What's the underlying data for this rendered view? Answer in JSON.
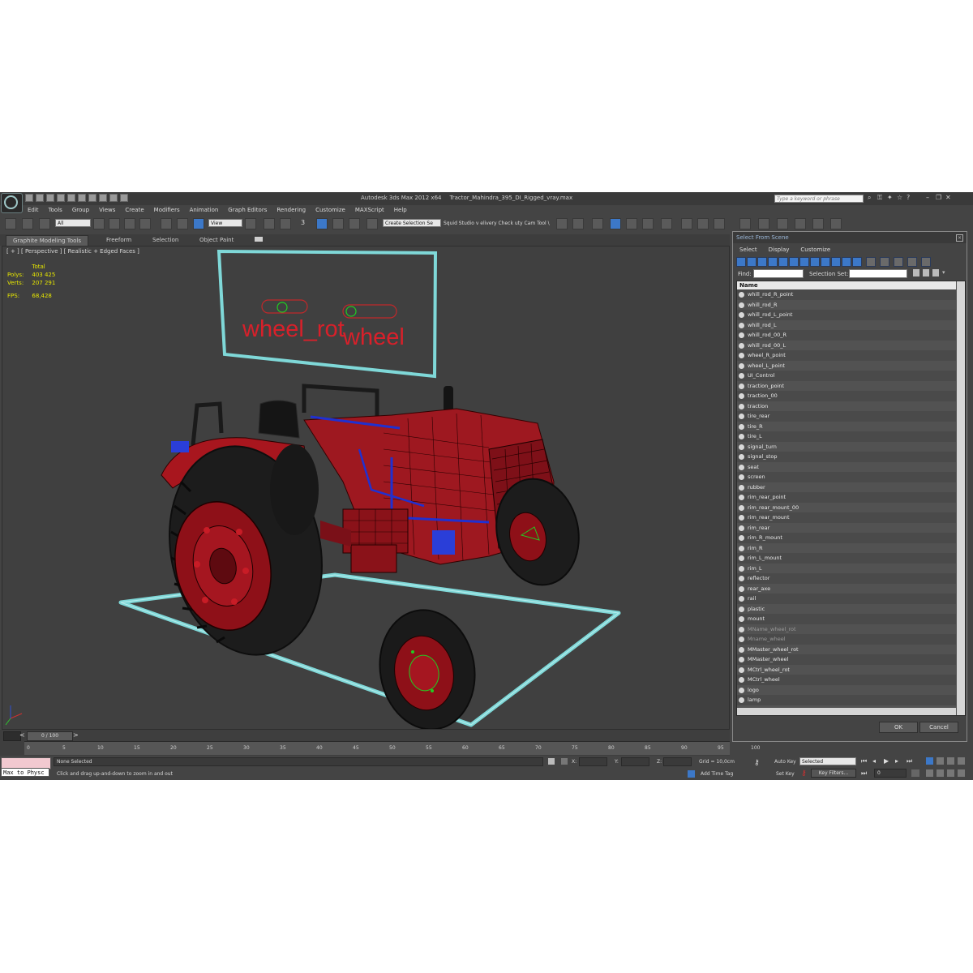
{
  "window": {
    "app_name": "Autodesk 3ds Max  2012 x64",
    "file_name": "Tractor_Mahindra_395_DI_Rigged_vray.max",
    "search_placeholder": "Type a keyword or phrase"
  },
  "menu": [
    "Edit",
    "Tools",
    "Group",
    "Views",
    "Create",
    "Modifiers",
    "Animation",
    "Graph Editors",
    "Rendering",
    "Customize",
    "MAXScript",
    "Help"
  ],
  "toolbar": {
    "filter_select": "All",
    "ref_coord_select": "View",
    "snap_label": "3",
    "selection_set": "Create Selection Se",
    "plugin_text": "Squid Studio v elivery Check   uty Cam Tool \\"
  },
  "ribbon": {
    "tabs": [
      "Graphite Modeling Tools",
      "Freeform",
      "Selection",
      "Object Paint"
    ]
  },
  "viewport": {
    "label": "[ + ] [ Perspective ] [ Realistic + Edged Faces ]",
    "stats_header": "Total",
    "polys_label": "Polys:",
    "polys_value": "403 425",
    "verts_label": "Verts:",
    "verts_value": "207 291",
    "fps_label": "FPS:",
    "fps_value": "68,428",
    "board_label_1": "wheel_rot",
    "board_label_2": "wheel"
  },
  "timeline": {
    "frame": "0 / 100",
    "ticks": [
      "0",
      "5",
      "10",
      "15",
      "20",
      "25",
      "30",
      "35",
      "40",
      "45",
      "50",
      "55",
      "60",
      "65",
      "70",
      "75",
      "80",
      "85",
      "90",
      "95",
      "100"
    ]
  },
  "status": {
    "maxscript_text": "Max to Physc",
    "selection_text": "None Selected",
    "prompt_text": "Click and drag up-and-down to zoom in and out",
    "x_label": "X:",
    "y_label": "Y:",
    "z_label": "Z:",
    "grid_text": "Grid = 10,0cm",
    "add_time_tag": "Add Time Tag",
    "auto_key": "Auto Key",
    "set_key": "Set Key",
    "key_mode": "Selected",
    "key_filters": "Key Filters...",
    "frame_value": "0"
  },
  "dialog": {
    "title": "Select From Scene",
    "menu": [
      "Select",
      "Display",
      "Customize"
    ],
    "find_label": "Find:",
    "selection_set_label": "Selection Set:",
    "column_header": "Name",
    "ok_label": "OK",
    "cancel_label": "Cancel",
    "items": [
      "whill_rod_R_point",
      "whill_rod_R",
      "whill_rod_L_point",
      "whill_rod_L",
      "whill_rod_00_R",
      "whill_rod_00_L",
      "wheel_R_point",
      "wheel_L_point",
      "UI_Control",
      "traction_point",
      "traction_00",
      "traction",
      "tire_rear",
      "tire_R",
      "tire_L",
      "signal_turn",
      "signal_stop",
      "seat",
      "screen",
      "rubber",
      "rim_rear_point",
      "rim_rear_mount_00",
      "rim_rear_mount",
      "rim_rear",
      "rim_R_mount",
      "rim_R",
      "rim_L_mount",
      "rim_L",
      "reflector",
      "rear_axe",
      "rail",
      "plastic",
      "mount",
      "MName_wheel_rot",
      "Mname_wheel",
      "MMaster_wheel_rot",
      "MMaster_wheel",
      "MCtrl_wheel_rot",
      "MCtrl_wheel",
      "logo",
      "lamp"
    ],
    "dim_items": [
      "MName_wheel_rot",
      "Mname_wheel"
    ]
  },
  "colors": {
    "accent_blue": "#3c78c8",
    "wire_red": "#c0282a",
    "helper_cyan": "#7fd8d8",
    "stats_yellow": "#e6e600"
  }
}
